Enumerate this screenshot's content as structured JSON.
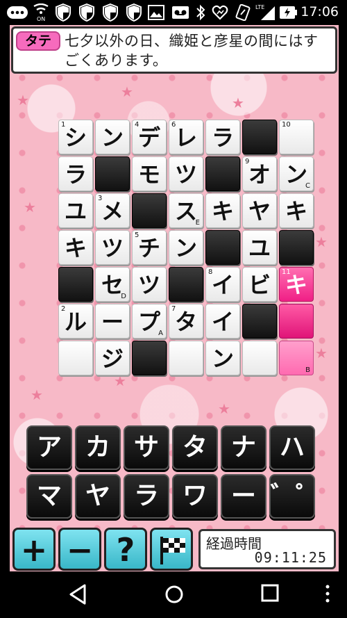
{
  "status_bar": {
    "time": "17:06",
    "icons": [
      "notification-icon",
      "nfc-on-icon",
      "shield-icon",
      "shield-icon",
      "shield-icon",
      "shield-icon",
      "image-icon",
      "voicemail-icon",
      "bluetooth-icon",
      "heart-icon",
      "nfc-icon",
      "lte-signal-icon",
      "battery-icon"
    ],
    "nfc_label": "ON",
    "lte_label": "LTE"
  },
  "clue": {
    "tag": "タテ",
    "text": "七夕以外の日、織姫と彦星の間にはすごくあります。"
  },
  "grid": {
    "rows": 7,
    "cols": 7,
    "cells": [
      [
        {
          "t": "w",
          "ch": "シ",
          "n": "1"
        },
        {
          "t": "w",
          "ch": "ン"
        },
        {
          "t": "w",
          "ch": "デ",
          "n": "4"
        },
        {
          "t": "w",
          "ch": "レ",
          "n": "6"
        },
        {
          "t": "w",
          "ch": "ラ"
        },
        {
          "t": "b"
        },
        {
          "t": "w",
          "ch": "",
          "n": "10"
        }
      ],
      [
        {
          "t": "w",
          "ch": "ラ"
        },
        {
          "t": "b"
        },
        {
          "t": "w",
          "ch": "モ"
        },
        {
          "t": "w",
          "ch": "ツ"
        },
        {
          "t": "b"
        },
        {
          "t": "w",
          "ch": "オ",
          "n": "9"
        },
        {
          "t": "w",
          "ch": "ン",
          "l": "C"
        }
      ],
      [
        {
          "t": "w",
          "ch": "ユ"
        },
        {
          "t": "w",
          "ch": "メ",
          "n": "3"
        },
        {
          "t": "b"
        },
        {
          "t": "w",
          "ch": "ス",
          "l": "E"
        },
        {
          "t": "w",
          "ch": "キ"
        },
        {
          "t": "w",
          "ch": "ヤ"
        },
        {
          "t": "w",
          "ch": "キ"
        }
      ],
      [
        {
          "t": "w",
          "ch": "キ"
        },
        {
          "t": "w",
          "ch": "ツ"
        },
        {
          "t": "w",
          "ch": "チ",
          "n": "5"
        },
        {
          "t": "w",
          "ch": "ン"
        },
        {
          "t": "b"
        },
        {
          "t": "w",
          "ch": "ユ"
        },
        {
          "t": "b"
        }
      ],
      [
        {
          "t": "b"
        },
        {
          "t": "w",
          "ch": "セ",
          "l": "D"
        },
        {
          "t": "w",
          "ch": "ツ"
        },
        {
          "t": "b"
        },
        {
          "t": "w",
          "ch": "イ",
          "n": "8"
        },
        {
          "t": "w",
          "ch": "ビ"
        },
        {
          "t": "s",
          "ch": "キ",
          "n": "11"
        }
      ],
      [
        {
          "t": "w",
          "ch": "ル",
          "n": "2"
        },
        {
          "t": "w",
          "ch": "ー"
        },
        {
          "t": "w",
          "ch": "プ",
          "l": "A"
        },
        {
          "t": "w",
          "ch": "タ",
          "n": "7"
        },
        {
          "t": "w",
          "ch": "イ"
        },
        {
          "t": "b"
        },
        {
          "t": "p",
          "ch": ""
        }
      ],
      [
        {
          "t": "w",
          "ch": ""
        },
        {
          "t": "w",
          "ch": "ジ"
        },
        {
          "t": "b"
        },
        {
          "t": "w",
          "ch": ""
        },
        {
          "t": "w",
          "ch": "ン"
        },
        {
          "t": "w",
          "ch": ""
        },
        {
          "t": "q",
          "ch": "",
          "l": "B"
        }
      ]
    ]
  },
  "keyboard": {
    "row1": [
      "ア",
      "カ",
      "サ",
      "タ",
      "ナ",
      "ハ"
    ],
    "row2": [
      "マ",
      "ヤ",
      "ラ",
      "ワ",
      "ー",
      "゛゜"
    ]
  },
  "toolbar": {
    "plus": "+",
    "minus": "−",
    "hint": "?",
    "finish_icon": "checkered-flag-icon"
  },
  "timer": {
    "label": "経過時間",
    "value": "09:11:25"
  },
  "colors": {
    "accent_pink": "#f01f86",
    "tool_cyan": "#39b7c8",
    "background_pink": "#f7b9c7"
  }
}
